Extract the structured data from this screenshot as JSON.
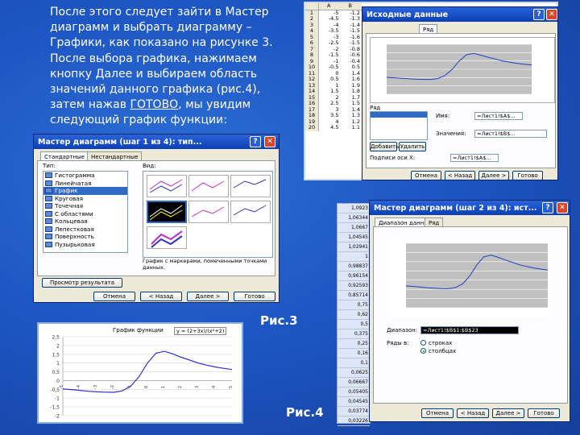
{
  "slide": {
    "text_lines": [
      "После этого следует зайти в Мастер",
      "диаграмм и выбрать диаграмму –",
      "Графики, как показано на рисунке 3.",
      "После выбора графика, нажимаем",
      "кнопку Далее и выбираем область",
      "значений данного графика (рис.4),"
    ],
    "line7_before": "затем нажав ",
    "line7_link": "ГОТОВО",
    "line7_after": ", мы увидим",
    "line8": "следующий график функции:",
    "caption_fig3": "Рис.3",
    "caption_fig4": "Рис.4"
  },
  "wizard_step1": {
    "title": "Мастер диаграмм (шаг 1 из 4): тип...",
    "tabs": [
      "Стандартные",
      "Нестандартные"
    ],
    "type_label": "Тип:",
    "view_label": "Вид:",
    "types": [
      "Гистограмма",
      "Линейчатая",
      "График",
      "Круговая",
      "Точечная",
      "С областями",
      "Кольцевая",
      "Лепестковая",
      "Поверхность",
      "Пузырьковая"
    ],
    "selected_type": "График",
    "description": "График с маркерами, помеченными точками данных.",
    "preview_button": "Просмотр результата",
    "buttons": [
      "Отмена",
      "< Назад",
      "Далее >",
      "Готово"
    ]
  },
  "wizard_step2_top": {
    "title": "Исходные данные",
    "tab": "Ряд",
    "row_label": "Ряд",
    "name_label": "Имя:",
    "values_label": "Значения:",
    "name_value": "=Лист1!$A$...",
    "values_value": "=Лист1!$B$...",
    "add_button": "Добавить",
    "remove_button": "Удалить",
    "xlabels_label": "Подписи оси X:",
    "xlabels_value": "=Лист1!$A$...",
    "buttons": [
      "Отмена",
      "< Назад",
      "Далее >",
      "Готово"
    ]
  },
  "wizard_step2": {
    "title": "Мастер диаграмм (шаг 2 из 4): ист...",
    "tabs": [
      "Диапазон данных",
      "Ряд"
    ],
    "range_label": "Диапазон:",
    "range_value": "=Лист1!$B$1:$B$23",
    "rows_label": "Ряды в:",
    "rows_options": [
      "строках",
      "столбцах"
    ],
    "rows_selected": 1,
    "buttons": [
      "Отмена",
      "< Назад",
      "Далее >",
      "Готово"
    ]
  },
  "excel_top": {
    "col_a": "A",
    "col_b": "B",
    "rows": [
      {
        "n": "1",
        "a": "-5",
        "b": "-1.2"
      },
      {
        "n": "2",
        "a": "-4.5",
        "b": "-1.3"
      },
      {
        "n": "3",
        "a": "-4",
        "b": "-1.4"
      },
      {
        "n": "4",
        "a": "-3.5",
        "b": "-1.5"
      },
      {
        "n": "5",
        "a": "-3",
        "b": "-1.6"
      },
      {
        "n": "6",
        "a": "-2.5",
        "b": "-1.5"
      },
      {
        "n": "7",
        "a": "-2",
        "b": "-0.8"
      },
      {
        "n": "8",
        "a": "-1.5",
        "b": "-0.6"
      },
      {
        "n": "9",
        "a": "-1",
        "b": "-0.4"
      },
      {
        "n": "10",
        "a": "-0.5",
        "b": "0.5"
      },
      {
        "n": "11",
        "a": "0",
        "b": "1.4"
      },
      {
        "n": "12",
        "a": "0.5",
        "b": "1.6"
      },
      {
        "n": "13",
        "a": "1",
        "b": "1.9"
      },
      {
        "n": "14",
        "a": "1.5",
        "b": "1.8"
      },
      {
        "n": "15",
        "a": "2",
        "b": "1.7"
      },
      {
        "n": "16",
        "a": "2.5",
        "b": "1.5"
      },
      {
        "n": "17",
        "a": "3",
        "b": "1.4"
      },
      {
        "n": "18",
        "a": "3.5",
        "b": "1.3"
      },
      {
        "n": "19",
        "a": "4",
        "b": "1.2"
      },
      {
        "n": "20",
        "a": "4.5",
        "b": "1.1"
      }
    ]
  },
  "excel_right": {
    "values": [
      "1,0923",
      "1,06344",
      "1,0667",
      "1,04545",
      "1,02941",
      "1",
      "0,98837",
      "0,96154",
      "0,92593",
      "0,85714",
      "0,75",
      "0,62",
      "0,5",
      "0,375",
      "0,25",
      "0,16",
      "0,1",
      "0,0625",
      "0,06667",
      "0,05405",
      "0,04545",
      "0,03774",
      "0,03226"
    ]
  },
  "final_chart": {
    "title": "График функции",
    "formula": "y = (2+3x)/(x²+2)"
  },
  "chart_data": [
    {
      "type": "line",
      "title": "График функции",
      "x": [
        -5,
        -4.5,
        -4,
        -3.5,
        -3,
        -2.5,
        -2,
        -1.5,
        -1,
        -0.5,
        0,
        0.5,
        1,
        1.5,
        2,
        2.5,
        3,
        3.5,
        4,
        4.5,
        5
      ],
      "series": [
        {
          "values": [
            -0.48,
            -0.51,
            -0.56,
            -0.61,
            -0.64,
            -0.66,
            -0.67,
            -0.59,
            -0.33,
            0.22,
            1.0,
            1.56,
            1.67,
            1.52,
            1.33,
            1.17,
            1.0,
            0.88,
            0.78,
            0.7,
            0.63
          ]
        }
      ],
      "y_ticks": [
        "2,5",
        "2",
        "1,5",
        "1",
        "0,5",
        "0",
        "-0,5",
        "-1",
        "-1,5",
        "-2"
      ],
      "ylim": [
        -2,
        2.5
      ],
      "grid": true
    }
  ]
}
